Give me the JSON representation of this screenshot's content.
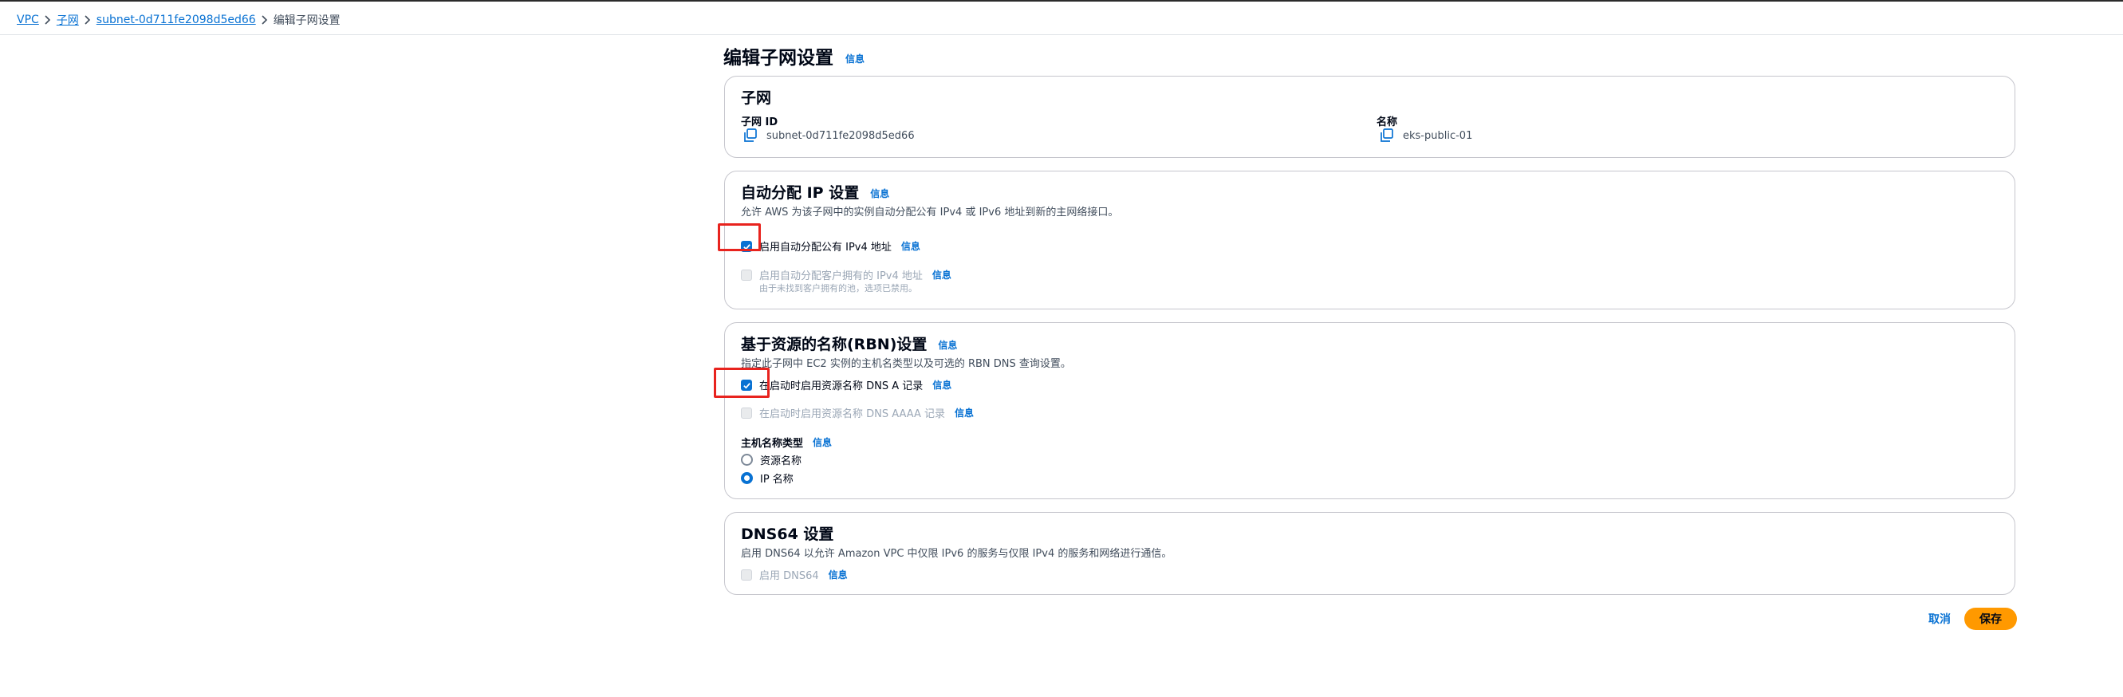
{
  "breadcrumb": {
    "items": [
      "VPC",
      "子网",
      "subnet-0d711fe2098d5ed66"
    ],
    "current": "编辑子网设置"
  },
  "page": {
    "title": "编辑子网设置",
    "info": "信息"
  },
  "subnet_section": {
    "title": "子网",
    "id_label": "子网 ID",
    "id_value": "subnet-0d711fe2098d5ed66",
    "name_label": "名称",
    "name_value": "eks-public-01"
  },
  "auto_ip_section": {
    "title": "自动分配 IP 设置",
    "info": "信息",
    "description": "允许 AWS 为该子网中的实例自动分配公有 IPv4 或 IPv6 地址到新的主网络接口。",
    "enable_public_ipv4": {
      "label": "启用自动分配公有 IPv4 地址",
      "info": "信息",
      "checked": true
    },
    "enable_customer_ipv4": {
      "label": "启用自动分配客户拥有的 IPv4 地址",
      "info": "信息",
      "note": "由于未找到客户拥有的池，选项已禁用。",
      "disabled": true
    }
  },
  "rbn_section": {
    "title": "基于资源的名称(RBN)设置",
    "info": "信息",
    "description": "指定此子网中 EC2 实例的主机名类型以及可选的 RBN DNS 查询设置。",
    "dns_a": {
      "label": "在启动时启用资源名称 DNS A 记录",
      "info": "信息",
      "checked": true
    },
    "dns_aaaa": {
      "label": "在启动时启用资源名称 DNS AAAA 记录",
      "info": "信息",
      "disabled": true
    },
    "hostname_type_label": "主机名称类型",
    "hostname_info": "信息",
    "hostname_options": [
      "资源名称",
      "IP 名称"
    ],
    "hostname_selected": "IP 名称"
  },
  "dns64_section": {
    "title": "DNS64 设置",
    "description": "启用 DNS64 以允许 Amazon VPC 中仅限 IPv6 的服务与仅限 IPv4 的服务和网络进行通信。",
    "enable_dns64": {
      "label": "启用 DNS64",
      "info": "信息",
      "disabled": true
    }
  },
  "actions": {
    "cancel": "取消",
    "save": "保存"
  },
  "colors": {
    "link": "#0972d3",
    "primary_button": "#ff9900",
    "highlight": "#e8231e"
  },
  "icons": [
    "chevron-right-icon",
    "copy-icon",
    "checkmark-icon"
  ]
}
